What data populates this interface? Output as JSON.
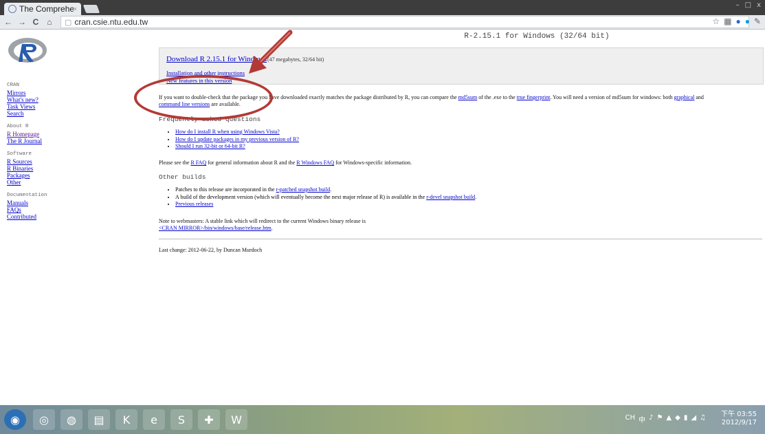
{
  "browser": {
    "tab_title": "The Compreher",
    "tab_close": "×",
    "url": "cran.csie.ntu.edu.tw",
    "back_icon": "←",
    "forward_icon": "→",
    "reload_icon": "C",
    "home_icon": "⌂",
    "page_icon": "▢",
    "star_icon": "☆",
    "win_controls": [
      "–",
      "□",
      "x"
    ]
  },
  "sidebar": {
    "sections": [
      {
        "title": "CRAN",
        "links": [
          "Mirrors",
          "What's new?",
          "Task Views",
          "Search"
        ]
      },
      {
        "title": "About R",
        "links": [
          "R Homepage",
          "The R Journal"
        ]
      },
      {
        "title": "Software",
        "links": [
          "R Sources",
          "R Binaries",
          "Packages",
          "Other"
        ]
      },
      {
        "title": "Documentation",
        "links": [
          "Manuals",
          "FAQs",
          "Contributed"
        ]
      }
    ]
  },
  "main": {
    "title": "R-2.15.1 for Windows (32/64 bit)",
    "download_link": "Download R 2.15.1 for Windows",
    "download_size": "(47 megabytes, 32/64 bit)",
    "install_link": "Installation and other instructions",
    "new_features_link": "New features in this version",
    "md5_text_1": "If you want to double-check that the package you have downloaded exactly matches the package distributed by R, you can compare the",
    "md5_link": "md5sum",
    "md5_text_2": "of the .exe to the",
    "fingerprint_link": "true fingerprint",
    "md5_text_3": ". You will need a version of md5sum for windows: both",
    "graphical_link": "graphical",
    "md5_text_4": "and",
    "cmdline_link": "command line versions",
    "md5_text_5": "are available.",
    "faq_heading": "Frequently asked questions",
    "faq_items": [
      "How do I install R when using Windows Vista?",
      "How do I update packages in my previous version of R?",
      "Should I run 32-bit or 64-bit R?"
    ],
    "see_text_1": "Please see the",
    "rfaq_link": "R FAQ",
    "see_text_2": "for general information about R and the",
    "winfaq_link": "R Windows FAQ",
    "see_text_3": "for Windows-specific information.",
    "other_heading": "Other builds",
    "other_1_text": "Patches to this release are incorporated in the",
    "other_1_link": "r-patched snapshot build",
    "other_2_text": "A build of the development version (which will eventually become the next major release of R) is available in the",
    "other_2_link": "r-devel snapshot build",
    "other_3_link": "Previous releases",
    "webmaster_text": "Note to webmasters: A stable link which will redirect to the current Windows binary release is",
    "webmaster_link": "<CRAN MIRROR>/bin/windows/base/release.htm",
    "last_change": "Last change: 2012-06-22, by Duncan Murdoch"
  },
  "taskbar": {
    "apps": [
      "start-orb",
      "chrome",
      "firefox",
      "explorer",
      "kugou",
      "internet-explorer",
      "skype",
      "network-tool",
      "word"
    ],
    "app_glyphs": [
      "◉",
      "◎",
      "◍",
      "▤",
      "K",
      "e",
      "S",
      "✚",
      "W"
    ],
    "tray_text": [
      "CH",
      "中",
      "♪",
      "⚑",
      "▲",
      "◆",
      "▮",
      "◢",
      "♫"
    ],
    "clock_time": "下午 03:55",
    "clock_date": "2012/9/17"
  },
  "colors": {
    "link": "#0000cc",
    "annotation_ring": "#b23a36",
    "download_box": "#efefef"
  }
}
